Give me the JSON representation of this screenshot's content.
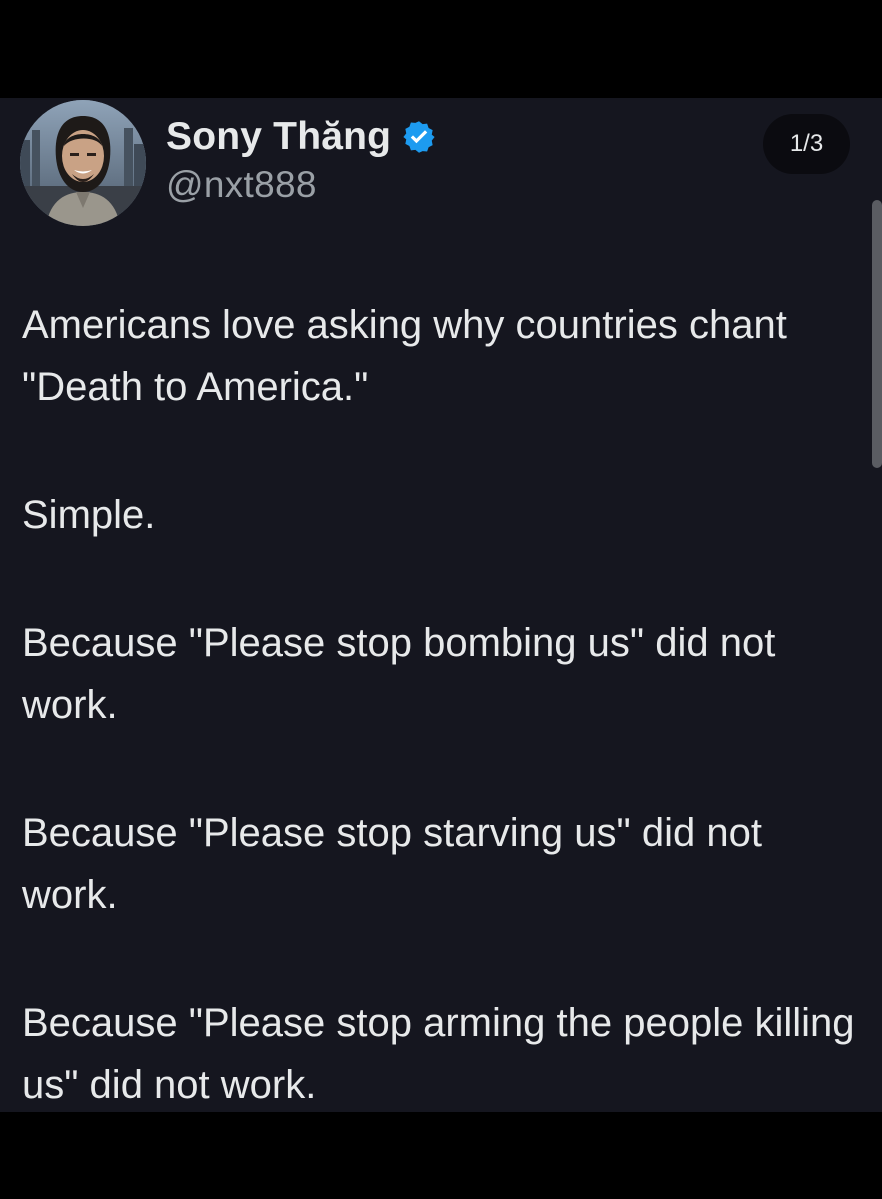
{
  "tweet": {
    "author": {
      "display_name": "Sony Thăng",
      "handle": "@nxt888",
      "verified": true,
      "verified_icon": "verified-badge-icon",
      "verified_color": "#1d9bf0"
    },
    "page_indicator": "1/3",
    "paragraphs": [
      "Americans love asking why countries chant \"Death to America.\"",
      "Simple.",
      "Because \"Please stop bombing us\" did not work.",
      "Because \"Please stop starving us\" did not work.",
      "Because \"Please stop arming the people killing us\" did not work."
    ]
  },
  "colors": {
    "background": "#15161f",
    "text": "#e7e9ea",
    "secondary_text": "#9aa0a6",
    "outer": "#000000"
  }
}
